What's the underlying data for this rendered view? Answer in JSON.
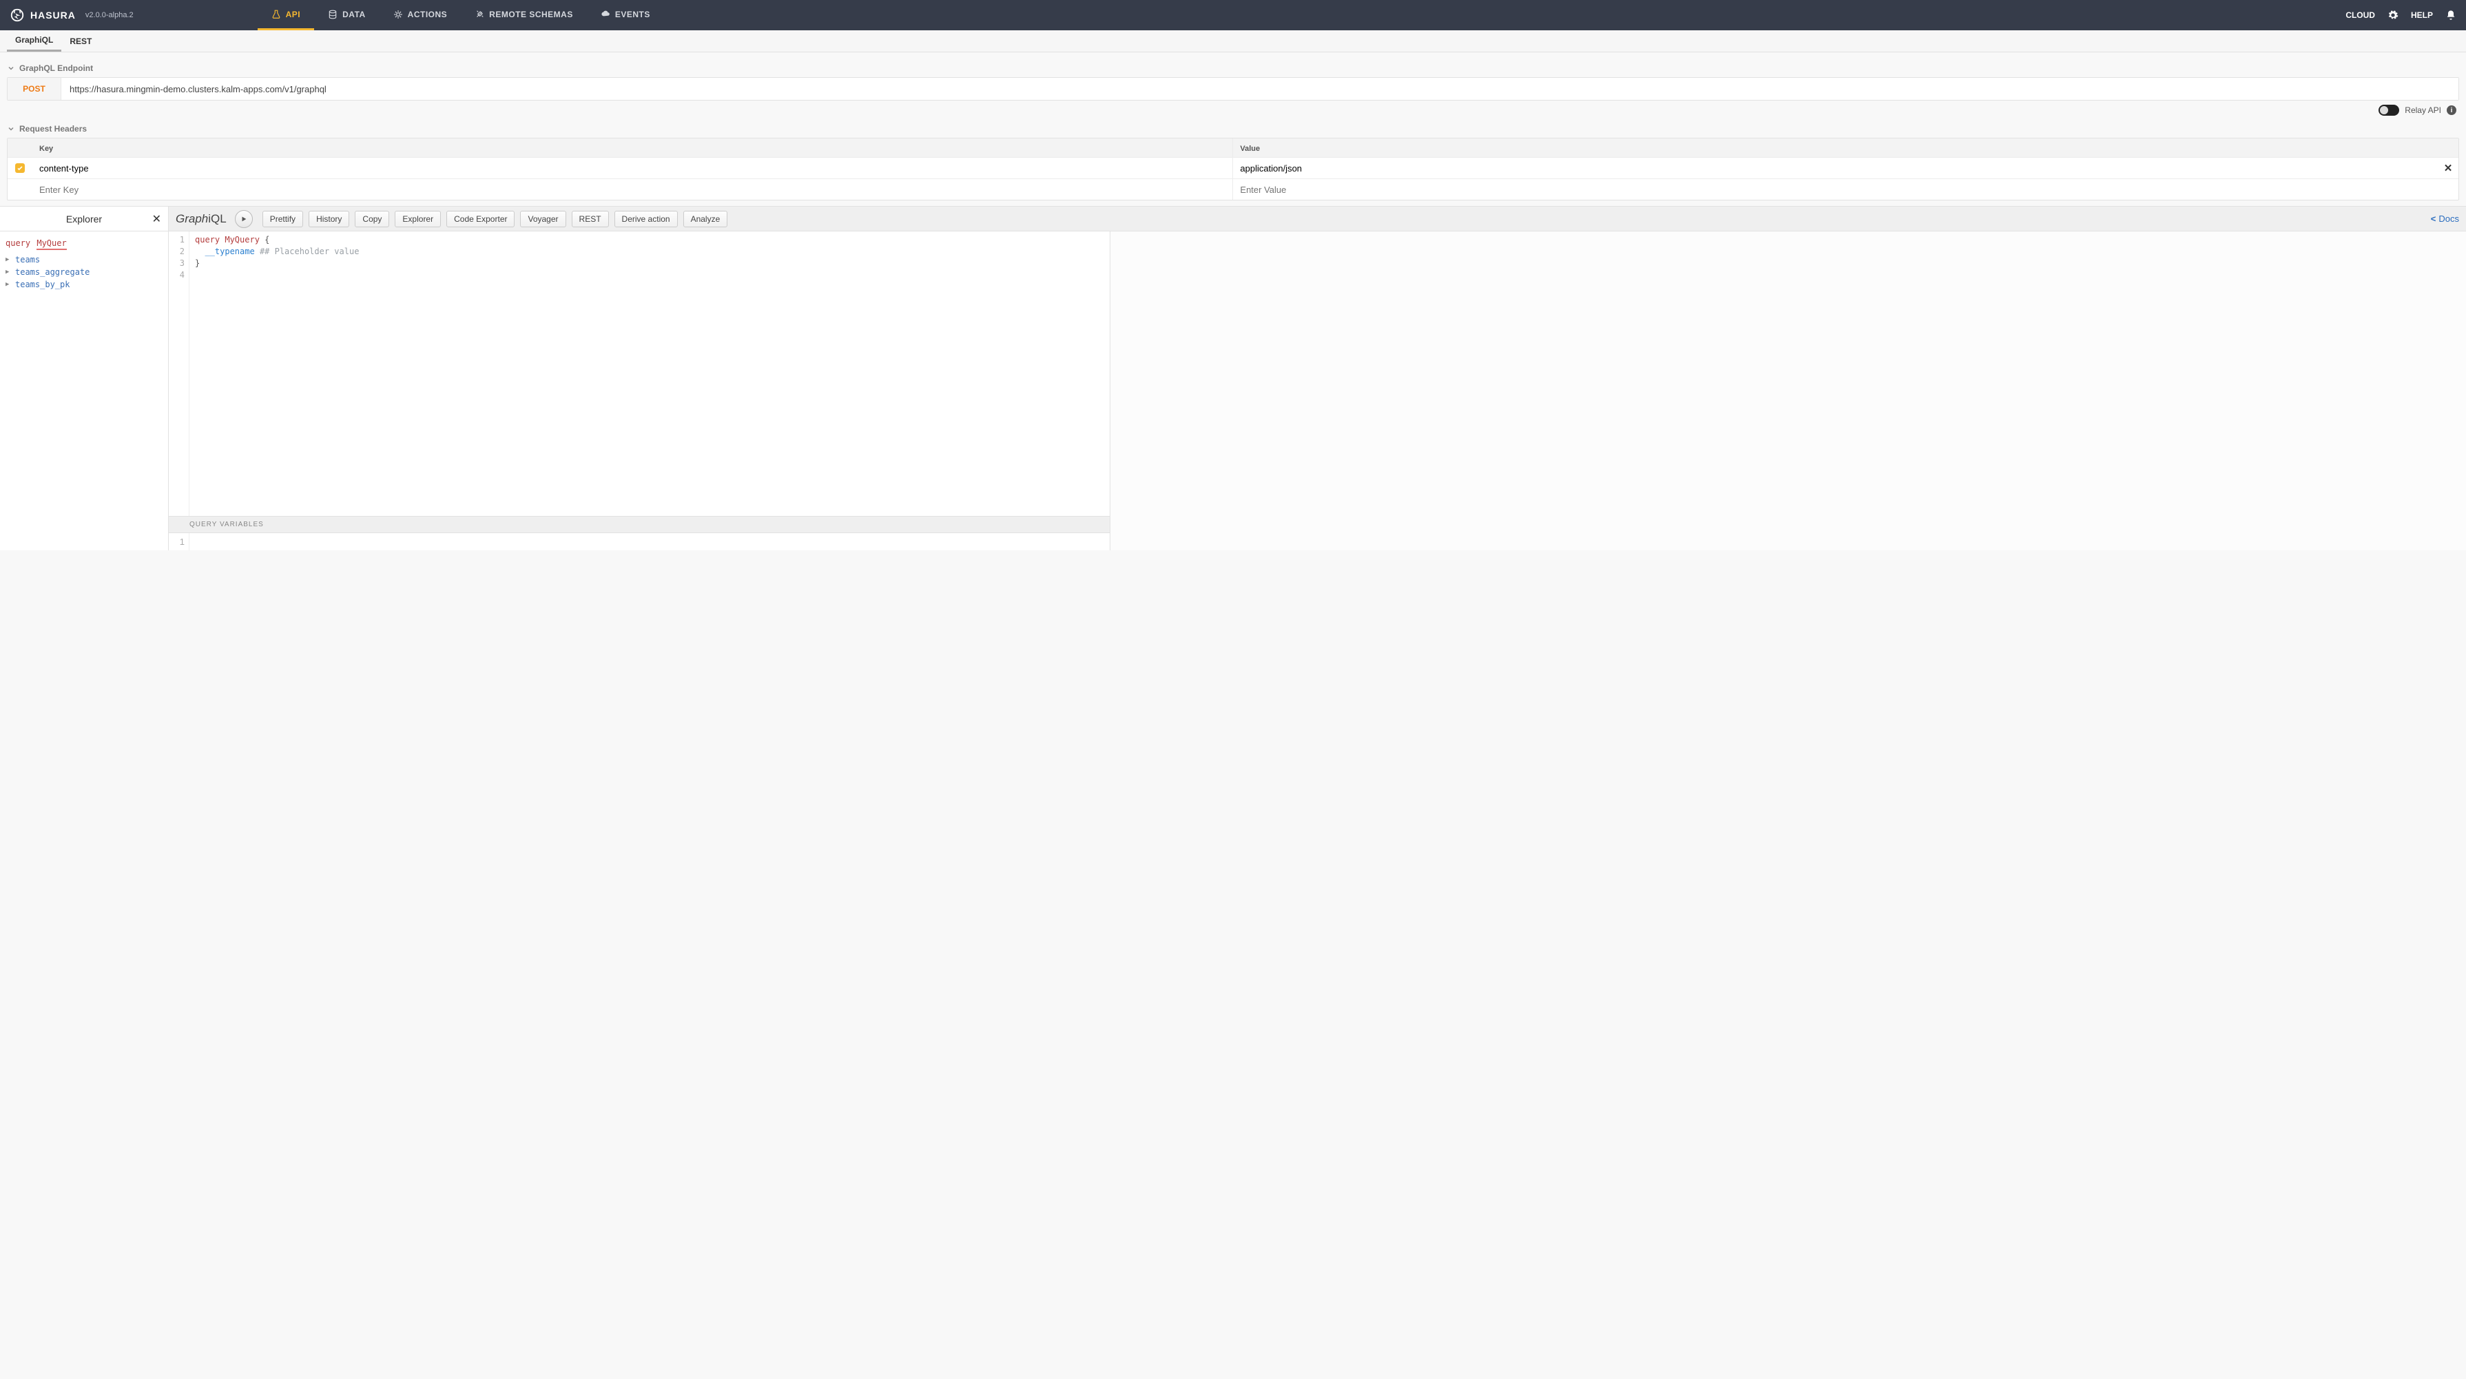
{
  "brand": {
    "name": "HASURA",
    "version": "v2.0.0-alpha.2"
  },
  "nav": {
    "items": [
      {
        "id": "api",
        "label": "API",
        "active": true
      },
      {
        "id": "data",
        "label": "DATA",
        "active": false
      },
      {
        "id": "actions",
        "label": "ACTIONS",
        "active": false
      },
      {
        "id": "remote-schemas",
        "label": "REMOTE SCHEMAS",
        "active": false
      },
      {
        "id": "events",
        "label": "EVENTS",
        "active": false
      }
    ],
    "right": {
      "cloud": "CLOUD",
      "help": "HELP"
    }
  },
  "subtabs": {
    "graphiql": "GraphiQL",
    "rest": "REST"
  },
  "endpoint": {
    "section_label": "GraphQL Endpoint",
    "method": "POST",
    "url": "https://hasura.mingmin-demo.clusters.kalm-apps.com/v1/graphql"
  },
  "relay": {
    "label": "Relay API",
    "on": false
  },
  "headers": {
    "section_label": "Request Headers",
    "col_key": "Key",
    "col_value": "Value",
    "rows": [
      {
        "enabled": true,
        "key": "content-type",
        "value": "application/json"
      }
    ],
    "key_placeholder": "Enter Key",
    "value_placeholder": "Enter Value"
  },
  "explorer": {
    "title": "Explorer",
    "query_keyword": "query",
    "query_name": "MyQuer",
    "items": [
      {
        "name": "teams"
      },
      {
        "name": "teams_aggregate"
      },
      {
        "name": "teams_by_pk"
      }
    ]
  },
  "graphiql": {
    "title": "GraphiQL",
    "toolbar": {
      "prettify": "Prettify",
      "history": "History",
      "copy": "Copy",
      "explorer": "Explorer",
      "code_exporter": "Code Exporter",
      "voyager": "Voyager",
      "rest": "REST",
      "derive": "Derive action",
      "analyze": "Analyze",
      "docs": "Docs"
    },
    "code": {
      "lines": [
        "1",
        "2",
        "3",
        "4"
      ],
      "kw_query": "query",
      "name": "MyQuery",
      "brace_open": "{",
      "field": "__typename",
      "comment": "## Placeholder value",
      "brace_close": "}"
    },
    "qvars_label": "Query Variables",
    "qvars_line": "1"
  }
}
